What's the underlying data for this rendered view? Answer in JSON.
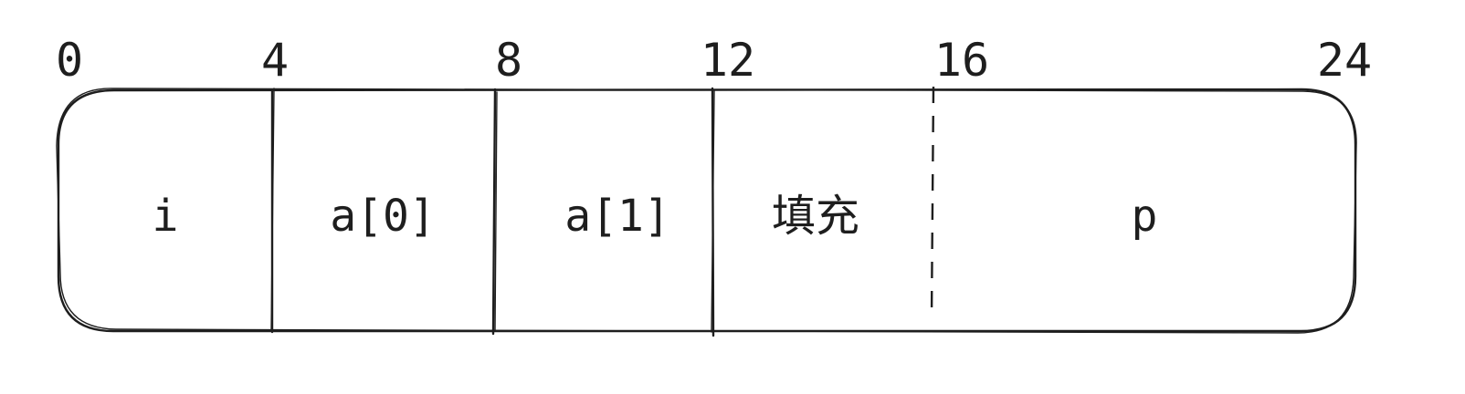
{
  "offsets": [
    "0",
    "4",
    "8",
    "12",
    "16",
    "24"
  ],
  "fields": [
    {
      "label": "i",
      "from": 0,
      "to": 4,
      "kind": "member"
    },
    {
      "label": "a[0]",
      "from": 4,
      "to": 8,
      "kind": "member"
    },
    {
      "label": "a[1]",
      "from": 8,
      "to": 12,
      "kind": "member"
    },
    {
      "label": "填充",
      "from": 12,
      "to": 16,
      "kind": "padding"
    },
    {
      "label": "p",
      "from": 16,
      "to": 24,
      "kind": "member"
    }
  ]
}
